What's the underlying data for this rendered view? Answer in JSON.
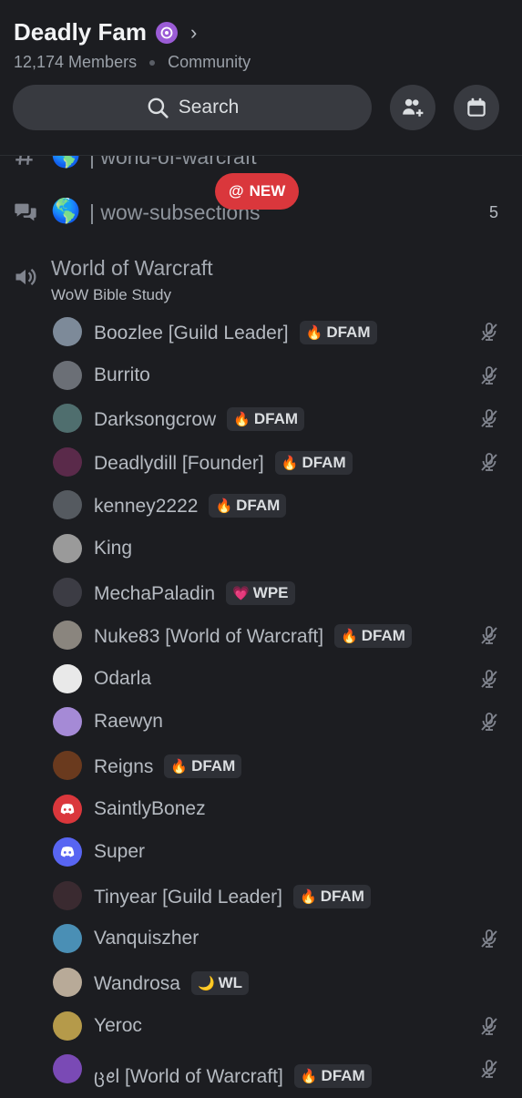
{
  "server": {
    "name": "Deadly Fam",
    "members": "12,174 Members",
    "type": "Community"
  },
  "search": {
    "label": "Search"
  },
  "channels": [
    {
      "globe": "🌎",
      "name": "| world-of-warcraft",
      "count": ""
    },
    {
      "globe": "🌎",
      "name": "| wow-subsections",
      "count": "5"
    }
  ],
  "new_pill": {
    "at": "@",
    "label": "NEW"
  },
  "voice_channel": {
    "name": "World of Warcraft",
    "status": "WoW Bible Study"
  },
  "members": [
    {
      "name": "Boozlee [Guild Leader]",
      "tag": "DFAM",
      "tag_emoji": "🔥",
      "muted": true,
      "avatar_color": "#7d8a99"
    },
    {
      "name": "Burrito",
      "tag": "",
      "tag_emoji": "",
      "muted": true,
      "avatar_color": "#6b6f76"
    },
    {
      "name": "Darksongcrow",
      "tag": "DFAM",
      "tag_emoji": "🔥",
      "muted": true,
      "avatar_color": "#4f6e6e"
    },
    {
      "name": "Deadlydill [Founder]",
      "tag": "DFAM",
      "tag_emoji": "🔥",
      "muted": true,
      "avatar_color": "#5a2a4a"
    },
    {
      "name": "kenney2222",
      "tag": "DFAM",
      "tag_emoji": "🔥",
      "muted": false,
      "avatar_color": "#555a60"
    },
    {
      "name": "King",
      "tag": "",
      "tag_emoji": "",
      "muted": false,
      "avatar_color": "#9a9a9a"
    },
    {
      "name": "MechaPaladin",
      "tag": "WPE",
      "tag_emoji": "💗",
      "muted": false,
      "avatar_color": "#3c3c44"
    },
    {
      "name": "Nuke83 [World of Warcraft]",
      "tag": "DFAM",
      "tag_emoji": "🔥",
      "muted": true,
      "avatar_color": "#8a857e"
    },
    {
      "name": "Odarla",
      "tag": "",
      "tag_emoji": "",
      "muted": true,
      "avatar_color": "#e9e9e9"
    },
    {
      "name": "Raewyn",
      "tag": "",
      "tag_emoji": "",
      "muted": true,
      "avatar_color": "#a58ad6"
    },
    {
      "name": "Reigns",
      "tag": "DFAM",
      "tag_emoji": "🔥",
      "muted": false,
      "avatar_color": "#6a3a1e"
    },
    {
      "name": "SaintlyBonez",
      "tag": "",
      "tag_emoji": "",
      "muted": false,
      "avatar_color": "#da373c",
      "discord": true
    },
    {
      "name": "Super",
      "tag": "",
      "tag_emoji": "",
      "muted": false,
      "avatar_color": "#5865f2",
      "discord": true
    },
    {
      "name": "Tinyear [Guild Leader]",
      "tag": "DFAM",
      "tag_emoji": "🔥",
      "muted": false,
      "avatar_color": "#3a2a30"
    },
    {
      "name": "Vanquiszher",
      "tag": "",
      "tag_emoji": "",
      "muted": true,
      "avatar_color": "#4a8fb5"
    },
    {
      "name": "Wandrosa",
      "tag": "WL",
      "tag_emoji": "🌙",
      "muted": false,
      "avatar_color": "#b8aa98"
    },
    {
      "name": "Yeroc",
      "tag": "",
      "tag_emoji": "",
      "muted": true,
      "avatar_color": "#b59a4a"
    },
    {
      "name": "ცꫀl [World of Warcraft]",
      "tag": "DFAM",
      "tag_emoji": "🔥",
      "muted": true,
      "avatar_color": "#7a4ab5"
    }
  ]
}
